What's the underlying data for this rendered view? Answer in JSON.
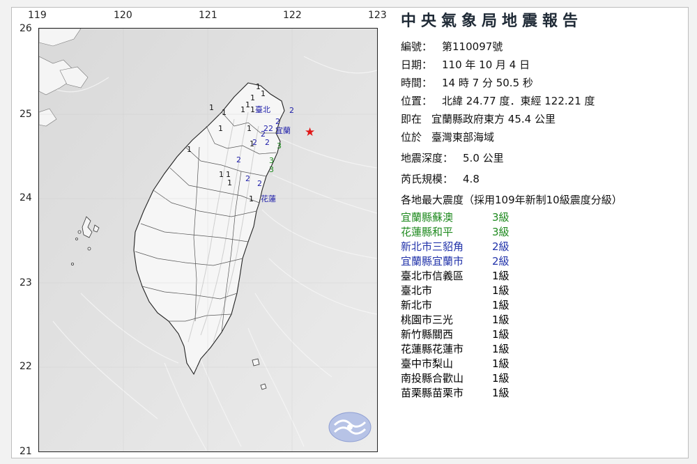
{
  "map": {
    "longitude_labels": [
      "119",
      "120",
      "121",
      "122",
      "123"
    ],
    "latitude_labels": [
      "26",
      "25",
      "24",
      "23",
      "22",
      "21"
    ],
    "city_labels": [
      "臺北",
      "宜蘭",
      "花蓮"
    ],
    "intensity_markers": [
      "1",
      "1",
      "1",
      "1",
      "1",
      "1",
      "1",
      "1",
      "1",
      "1",
      "1",
      "1",
      "1",
      "1",
      "1",
      "1",
      "2",
      "2",
      "2",
      "2",
      "2",
      "2",
      "2",
      "2",
      "2",
      "2",
      "3",
      "3",
      "3"
    ],
    "epicenter_symbol": "★",
    "colors": {
      "level1": "#111111",
      "level2": "#2222aa",
      "level3": "#1f8a1f",
      "epicenter": "#e01818"
    }
  },
  "report": {
    "title": "中央氣象局地震報告",
    "number_label": "編號：",
    "number_value": "第110097號",
    "date_label": "日期：",
    "date_value": "110 年 10 月 4 日",
    "time_label": "時間：",
    "time_value": "14 時 7 分 50.5 秒",
    "position_label": "位置：",
    "position_value": "北緯 24.77 度．東經 122.21 度",
    "located_label": "即在",
    "located_value": "宜蘭縣政府東方 45.4 公里",
    "region_label": "位於",
    "region_value": "臺灣東部海域",
    "depth_label": "地震深度：",
    "depth_value": "5.0 公里",
    "magnitude_label": "芮氏規模：",
    "magnitude_value": "4.8",
    "intensity_heading": "各地最大震度（採用109年新制10級震度分級）"
  },
  "intensities": [
    {
      "site": "宜蘭縣蘇澳",
      "level": "3級",
      "color": "#1f8a1f"
    },
    {
      "site": "花蓮縣和平",
      "level": "3級",
      "color": "#1f8a1f"
    },
    {
      "site": "新北市三貂角",
      "level": "2級",
      "color": "#2233aa"
    },
    {
      "site": "宜蘭縣宜蘭市",
      "level": "2級",
      "color": "#2233aa"
    },
    {
      "site": "臺北市信義區",
      "level": "1級",
      "color": "#111111"
    },
    {
      "site": "臺北市",
      "level": "1級",
      "color": "#111111"
    },
    {
      "site": "新北市",
      "level": "1級",
      "color": "#111111"
    },
    {
      "site": "桃園市三光",
      "level": "1級",
      "color": "#111111"
    },
    {
      "site": "新竹縣關西",
      "level": "1級",
      "color": "#111111"
    },
    {
      "site": "花蓮縣花蓮市",
      "level": "1級",
      "color": "#111111"
    },
    {
      "site": "臺中市梨山",
      "level": "1級",
      "color": "#111111"
    },
    {
      "site": "南投縣合歡山",
      "level": "1級",
      "color": "#111111"
    },
    {
      "site": "苗栗縣苗栗市",
      "level": "1級",
      "color": "#111111"
    }
  ]
}
